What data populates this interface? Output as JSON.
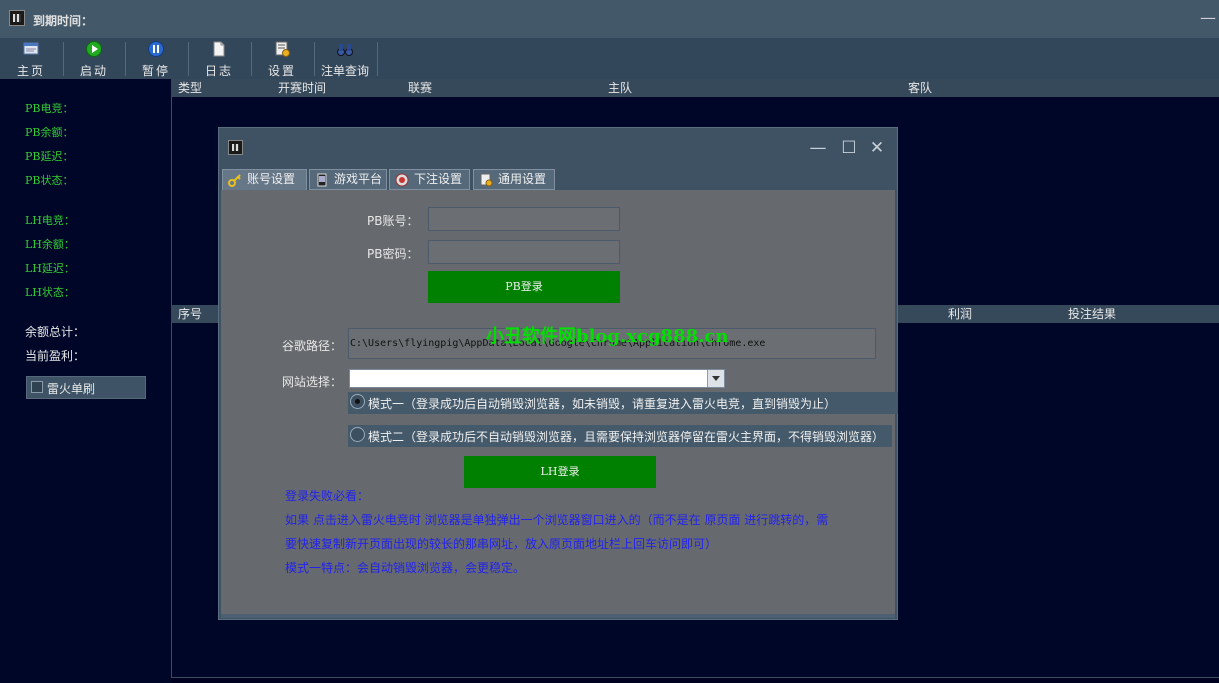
{
  "window": {
    "title": "到期时间："
  },
  "toolbar": {
    "items": [
      {
        "label": "主页",
        "icon": "home-icon"
      },
      {
        "label": "启动",
        "icon": "play-icon"
      },
      {
        "label": "暂停",
        "icon": "pause-icon"
      },
      {
        "label": "日志",
        "icon": "log-icon"
      },
      {
        "label": "设置",
        "icon": "settings-icon"
      },
      {
        "label": "注单查询",
        "icon": "binoculars-icon"
      }
    ]
  },
  "left_panel": {
    "pb": [
      "PB电竞：",
      "PB余额：",
      "PB延迟：",
      "PB状态："
    ],
    "lh": [
      "LH电竞：",
      "LH余额：",
      "LH延迟：",
      "LH状态："
    ],
    "total_balance": "余额总计：",
    "current_profit": "当前盈利：",
    "fire_checkbox": "雷火单刷"
  },
  "grid_top": {
    "columns": [
      "类型",
      "开赛时间",
      "联赛",
      "主队",
      "客队"
    ]
  },
  "grid_bottom": {
    "columns": [
      "序号",
      "利润",
      "投注结果"
    ]
  },
  "dialog": {
    "tabs": [
      "账号设置",
      "游戏平台",
      "下注设置",
      "通用设置"
    ],
    "pb_account_label": "PB账号：",
    "pb_password_label": "PB密码：",
    "pb_account_value": "",
    "pb_password_value": "",
    "pb_login": "PB登录",
    "chrome_path_label": "谷歌路径：",
    "chrome_path_value": "C:\\Users\\flyingpig\\AppData\\Local\\Google\\Chrome\\Application\\chrome.exe",
    "site_label": "网站选择：",
    "site_value": "",
    "mode1": "模式一（登录成功后自动销毁浏览器，如未销毁，请重复进入雷火电竞，直到销毁为止）",
    "mode2": "模式二（登录成功后不自动销毁浏览器，且需要保持浏览器停留在雷火主界面，不得销毁浏览器）",
    "lh_login": "LH登录",
    "notes": [
      "登录失败必看：",
      "如果 点击进入雷火电竞时 浏览器是单独弹出一个浏览器窗口进入的（而不是在 原页面 进行跳转的，需",
      "要快速复制新开页面出现的较长的那串网址，放入原页面地址栏上回车访问即可）",
      "模式一特点：会自动销毁浏览器，会更稳定。"
    ]
  },
  "watermark": "小丑软件网blog.xcg888.cn",
  "colors": {
    "green_button": "#008000",
    "status_text": "#33cc33",
    "note_text": "#2222ee"
  }
}
